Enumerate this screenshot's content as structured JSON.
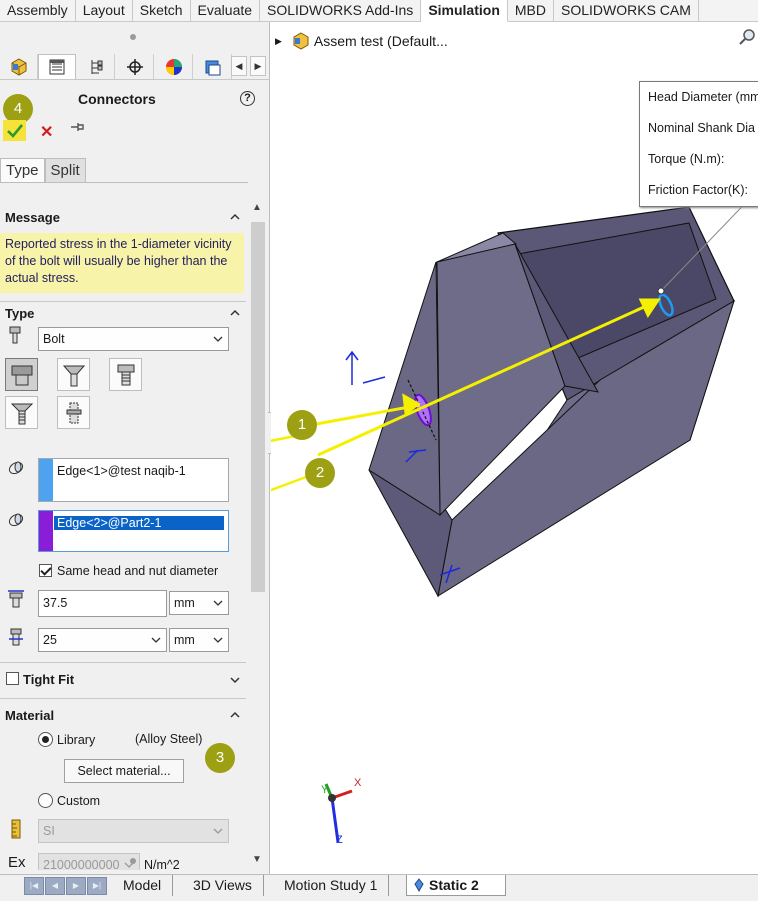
{
  "ribbon": {
    "tabs": [
      "Assembly",
      "Layout",
      "Sketch",
      "Evaluate",
      "SOLIDWORKS Add-Ins",
      "Simulation",
      "MBD",
      "SOLIDWORKS CAM"
    ],
    "active": "Simulation"
  },
  "pm": {
    "title": "Connectors",
    "help_label": "?",
    "subtabs": [
      "Type",
      "Split"
    ],
    "message": {
      "heading": "Message",
      "text": "Reported stress in the 1-diameter vicinity of the bolt will usually be higher than the actual stress."
    },
    "type_section": {
      "heading": "Type",
      "connector_type": "Bolt",
      "edge1": "Edge<1>@test naqib-1",
      "edge2": "Edge<2>@Part2-1",
      "same_diameter_label": "Same head and nut diameter",
      "same_diameter_checked": true,
      "head_diameter": "37.5",
      "head_unit": "mm",
      "shank_diameter": "25",
      "shank_unit": "mm"
    },
    "tight_fit": {
      "label": "Tight Fit",
      "checked": false
    },
    "material": {
      "heading": "Material",
      "library_label": "Library",
      "library_value": "(Alloy Steel)",
      "select_button": "Select material...",
      "custom_label": "Custom",
      "unit_system": "SI",
      "ex_label": "Ex",
      "ex_value": "21000000000",
      "ex_unit": "N/m^2"
    }
  },
  "badges": [
    "1",
    "2",
    "3",
    "4"
  ],
  "graphics": {
    "tree_item": "Assem test  (Default...",
    "callout": [
      "Head Diameter (mm",
      "Nominal Shank Dia",
      "Torque (N.m):",
      "Friction Factor(K):"
    ],
    "triad": {
      "x": "X",
      "y": "Y",
      "z": "Z"
    }
  },
  "bottom_tabs": {
    "tabs": [
      "Model",
      "3D Views",
      "Motion Study 1",
      "Static 2"
    ],
    "active": "Static 2"
  },
  "colors": {
    "badge": "#9ea014",
    "annotation_arrow": "#f5f000",
    "selection_highlight": "#0a64c8",
    "edge1_color": "#4da3f0",
    "edge2_color": "#8a1ed8",
    "part_face": "#6e6c88",
    "message_bg": "#f7f3a8"
  }
}
